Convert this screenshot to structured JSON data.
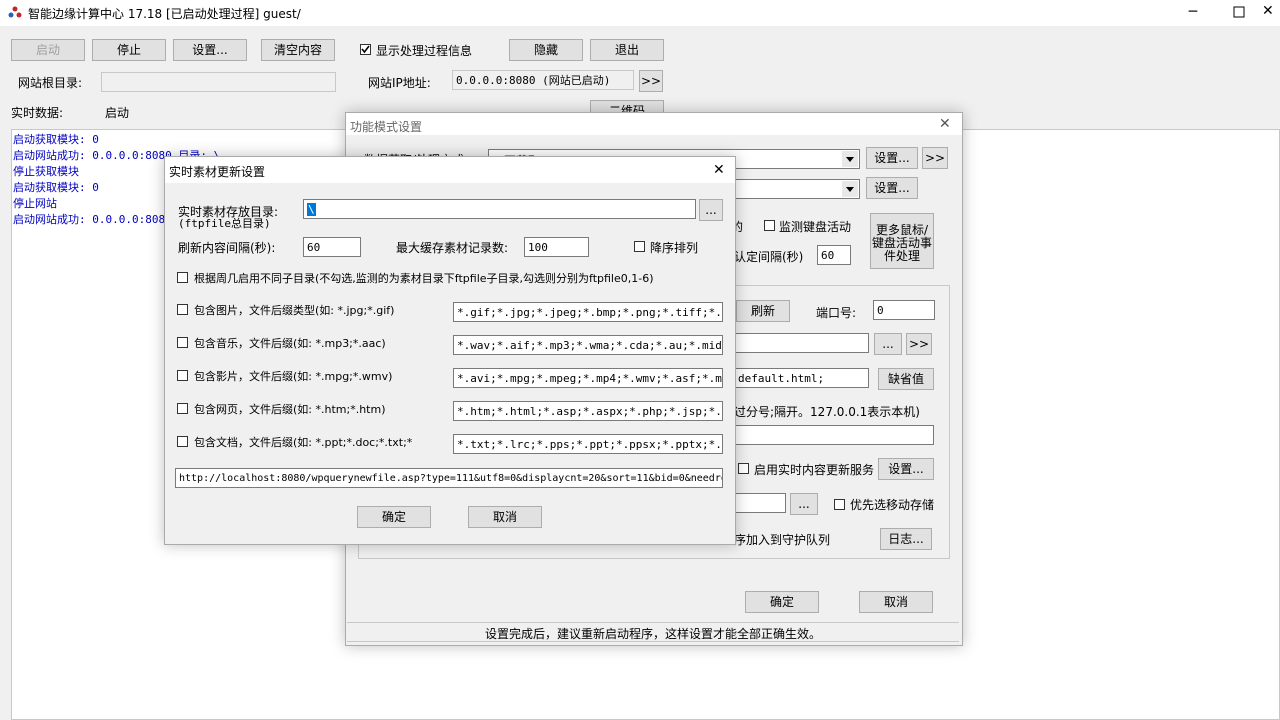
{
  "main_window": {
    "title": "智能边缘计算中心 17.18 [已启动处理过程] guest/",
    "buttons": {
      "start": "启动",
      "stop": "停止",
      "settings": "设置...",
      "clear": "清空内容",
      "hide": "隐藏",
      "exit": "退出",
      "more": ">>",
      "qr": "二维码"
    },
    "show_process_label": "显示处理过程信息",
    "show_process_checked": true,
    "web_root_label": "网站根目录:",
    "web_root_value": "",
    "web_ip_label": "网站IP地址:",
    "web_ip_value": "0.0.0.0:8080 (网站已启动)",
    "realtime_label": "实时数据:",
    "realtime_value": "启动",
    "log_lines": [
      "启动获取模块: 0",
      "启动网站成功: 0.0.0.0:8080 目录: \\",
      "停止获取模块",
      "启动获取模块: 0",
      "停止网站",
      "启动网站成功: 0.0.0.0:8080"
    ]
  },
  "mode_dialog": {
    "title": "功能模式设置",
    "data_mode_label": "数据获取/处理方式:",
    "data_mode_value": "0-不获取",
    "combo2_value": "",
    "settings1": "设置...",
    "more1": ">>",
    "settings2": "设置...",
    "partial_label": "的",
    "monitor_keyboard_label": "监测键盘活动",
    "more_mouse_button": "更多鼠标/键盘活动事件处理",
    "interval_label": "认定间隔(秒)",
    "interval_value": "60",
    "refresh_button": "刷新",
    "port_label": "端口号:",
    "port_value": "0",
    "browse1": "...",
    "more2": ">>",
    "default_page_value": "default.html;",
    "default_button": "缺省值",
    "ip_note": "过分号;隔开。127.0.0.1表示本机)",
    "enable_realtime_label": "启用实时内容更新服务",
    "settings3": "设置...",
    "browse2": "...",
    "mobile_storage_label": "优先选移动存储",
    "guard_label": "序加入到守护队列",
    "log_button": "日志...",
    "ok": "确定",
    "cancel": "取消",
    "status": "设置完成后，建议重新启动程序，这样设置才能全部正确生效。"
  },
  "realtime_dialog": {
    "title": "实时素材更新设置",
    "dir_label": "实时素材存放目录:",
    "dir_sub_label": "(ftpfile总目录)",
    "dir_value": "\\",
    "browse": "...",
    "refresh_label": "刷新内容间隔(秒):",
    "refresh_value": "60",
    "max_cache_label": "最大缓存素材记录数:",
    "max_cache_value": "100",
    "desc_sort_label": "降序排列",
    "weekday_label": "根据周几启用不同子目录(不勾选,监测的为素材目录下ftpfile子目录,勾选则分别为ftpfile0,1-6)",
    "options": [
      {
        "label": "包含图片，文件后缀类型(如: *.jpg;*.gif)",
        "value": "*.gif;*.jpg;*.jpeg;*.bmp;*.png;*.tiff;*.tif;"
      },
      {
        "label": "包含音乐，文件后缀(如: *.mp3;*.aac)",
        "value": "*.wav;*.aif;*.mp3;*.wma;*.cda;*.au;*.midi;*.aac"
      },
      {
        "label": "包含影片，文件后缀(如: *.mpg;*.wmv)",
        "value": "*.avi;*.mpg;*.mpeg;*.mp4;*.wmv;*.asf;*.m3u8;*.mov"
      },
      {
        "label": "包含网页，文件后缀(如: *.htm;*.htm)",
        "value": "*.htm;*.html;*.asp;*.aspx;*.php;*.jsp;*.shtml;"
      },
      {
        "label": "包含文档，文件后缀(如: *.ppt;*.doc;*.txt;*",
        "value": "*.txt;*.lrc;*.pps;*.ppt;*.ppsx;*.pptx;*.dot;*.doc"
      }
    ],
    "url_value": "http://localhost:8080/wpquerynewfile.asp?type=111&utf8=0&displaycnt=20&sort=11&bid=0&needre",
    "ok": "确定",
    "cancel": "取消"
  }
}
